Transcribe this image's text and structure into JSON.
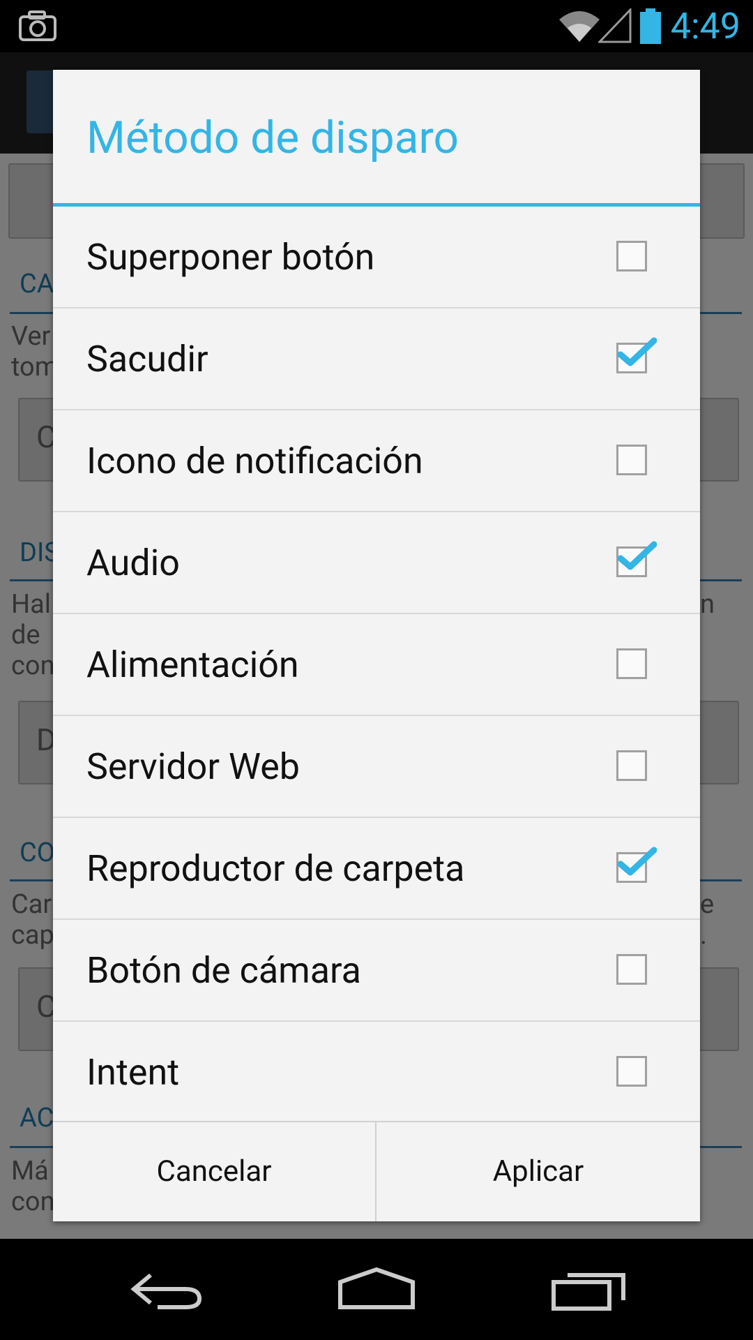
{
  "status_bar": {
    "time": "4:49",
    "accent_color": "#33b5e5"
  },
  "dialog": {
    "title": "Método de disparo",
    "items": [
      {
        "label": "Superponer botón",
        "checked": false
      },
      {
        "label": "Sacudir",
        "checked": true
      },
      {
        "label": "Icono de notificación",
        "checked": false
      },
      {
        "label": "Audio",
        "checked": true
      },
      {
        "label": "Alimentación",
        "checked": false
      },
      {
        "label": "Servidor Web",
        "checked": false
      },
      {
        "label": "Reproductor de carpeta",
        "checked": true
      },
      {
        "label": "Botón de cámara",
        "checked": false
      },
      {
        "label": "Intent",
        "checked": false
      }
    ],
    "cancel_label": "Cancelar",
    "apply_label": "Aplicar"
  },
  "background": {
    "fragments": [
      "CA",
      "Ver",
      "tom",
      "C",
      "DIS",
      "Hal",
      "de",
      "con",
      "D",
      "n",
      "CO",
      "Car",
      "cap",
      "e",
      ".",
      "C",
      "AC",
      "Má",
      "con"
    ]
  },
  "icons": {
    "status": [
      "camera-icon",
      "wifi-icon",
      "signal-icon",
      "battery-icon"
    ],
    "nav": [
      "back-icon",
      "home-icon",
      "recents-icon"
    ]
  }
}
